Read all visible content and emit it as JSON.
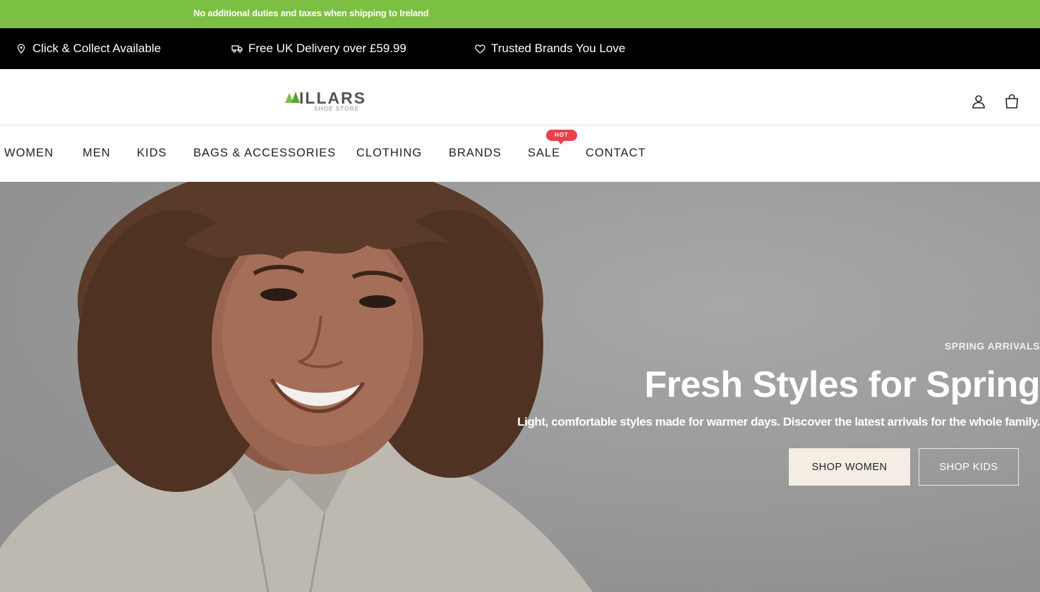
{
  "announcement": {
    "text": "No additional duties and taxes when shipping to Ireland"
  },
  "usps": [
    {
      "label": "Click & Collect Available",
      "icon": "pin-icon"
    },
    {
      "label": "Free UK Delivery over £59.99",
      "icon": "truck-icon"
    },
    {
      "label": "Trusted Brands You Love",
      "icon": "heart-icon"
    }
  ],
  "header": {
    "logo_text": "ILLARS",
    "logo_sub": "SHOE STORE",
    "icons": {
      "account": "account-icon",
      "bag": "shopping-bag-icon"
    }
  },
  "nav": {
    "items": [
      "WOMEN",
      "MEN",
      "KIDS",
      "BAGS & ACCESSORIES",
      "CLOTHING",
      "BRANDS",
      "SALE",
      "CONTACT"
    ],
    "badge": "HOT"
  },
  "hero": {
    "eyebrow": "SPRING ARRIVALS",
    "headline": "Fresh Styles for Spring",
    "lede": "Light, comfortable styles made for warmer days. Discover the latest arrivals for the whole family.",
    "primary_cta": "SHOP WOMEN",
    "secondary_cta": "SHOP KIDS"
  },
  "colors": {
    "brand_green": "#7cc043",
    "usp_bar": "#000000",
    "hot_badge": "#e8414a",
    "hero_overlay": "#9a9a9a"
  }
}
